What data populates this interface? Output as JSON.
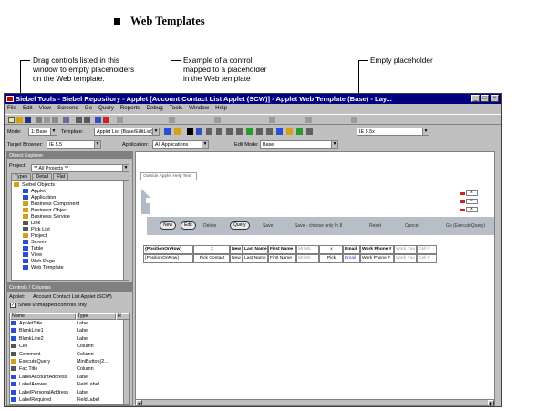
{
  "doc": {
    "heading": "Web Templates",
    "callouts": [
      "Drag controls listed in this\nwindow to empty placeholders\non the Web template.",
      "Example of a control\nmapped to a placeholder\nin the Web template",
      "Empty placeholder"
    ]
  },
  "window": {
    "title": "Siebel Tools - Siebel Repository - Applet [Account Contact List Applet (SCW)] - Applet Web Template (Base) - Lay...",
    "controls": [
      "_",
      "□",
      "×"
    ],
    "menu": [
      "File",
      "Edit",
      "View",
      "Screens",
      "Go",
      "Query",
      "Reports",
      "Debug",
      "Tools",
      "Window",
      "Help"
    ]
  },
  "toolbar2": {
    "mode_label": "Mode:",
    "mode_value": "1: Base",
    "template_label": "Template:",
    "template_value": "Applet List (Base/EditList)",
    "edit_combo": "IE 5.5x"
  },
  "toolbar3": {
    "browser_label": "Target Browser:",
    "browser_value": "IE 5.5",
    "application_label": "Application:",
    "application_value": "All Applications",
    "editmode_label": "Edit Mode:",
    "editmode_value": "Base"
  },
  "explorer": {
    "title": "Object Explorer",
    "project_label": "Project:",
    "project_value": "** All Projects **",
    "tabs": [
      "Types",
      "Detail",
      "Flat"
    ],
    "items": [
      {
        "label": "Siebel Objects",
        "color": "#d4a017"
      },
      {
        "label": "Applet",
        "color": "#2a4fd0"
      },
      {
        "label": "Application",
        "color": "#2a4fd0"
      },
      {
        "label": "Business Component",
        "color": "#d4a017"
      },
      {
        "label": "Business Object",
        "color": "#d4a017"
      },
      {
        "label": "Business Service",
        "color": "#d4a017"
      },
      {
        "label": "Link",
        "color": "#555555"
      },
      {
        "label": "Pick List",
        "color": "#555555"
      },
      {
        "label": "Project",
        "color": "#d4a017"
      },
      {
        "label": "Screen",
        "color": "#2a4fd0"
      },
      {
        "label": "Table",
        "color": "#2a4fd0"
      },
      {
        "label": "View",
        "color": "#2a4fd0"
      },
      {
        "label": "Web Page",
        "color": "#2a4fd0"
      },
      {
        "label": "Web Template",
        "color": "#2a4fd0"
      }
    ]
  },
  "controls_pane": {
    "title": "Controls / Columns",
    "applet_label": "Applet:",
    "applet_value": "Account Contact List Applet (SCW)",
    "checkbox_label": "Show unmapped controls only",
    "headers": [
      "Name",
      "Type",
      "H"
    ],
    "rows": [
      {
        "name": "AppletTitle",
        "type": "Label",
        "color": "#2a4fd0"
      },
      {
        "name": "BlankLine1",
        "type": "Label",
        "color": "#2a4fd0"
      },
      {
        "name": "BlankLine2",
        "type": "Label",
        "color": "#2a4fd0"
      },
      {
        "name": "Cell",
        "type": "Column",
        "color": "#555555"
      },
      {
        "name": "Comment",
        "type": "Column",
        "color": "#555555"
      },
      {
        "name": "ExecuteQuery",
        "type": "MiniButton(2...",
        "color": "#d4a017"
      },
      {
        "name": "Fax Title",
        "type": "Column",
        "color": "#555555"
      },
      {
        "name": "LabelAccountAddress",
        "type": "Label",
        "color": "#2a4fd0"
      },
      {
        "name": "LabelAnswer",
        "type": "FieldLabel",
        "color": "#2a4fd0"
      },
      {
        "name": "LabelPersonalAddress",
        "type": "Label",
        "color": "#2a4fd0"
      },
      {
        "name": "LabelRequired",
        "type": "FieldLabel",
        "color": "#2a4fd0"
      }
    ]
  },
  "template": {
    "outside_label": "Outside Applet Help Text",
    "buttons": [
      {
        "label": "New",
        "pill": true
      },
      {
        "label": "Edit",
        "pill": true
      },
      {
        "label": "Delete",
        "pill": false
      },
      {
        "label": "Query",
        "pill": true
      },
      {
        "label": "Save",
        "pill": false
      },
      {
        "label": "Save - choose only In 8",
        "pill": false
      },
      {
        "label": "Reset",
        "pill": false
      },
      {
        "label": "Cancel",
        "pill": false
      },
      {
        "label": "Go (ExecuteQuery)",
        "pill": false
      }
    ],
    "header_row": [
      "{PositionOnRow}",
      "x",
      "New",
      "Last Name",
      "First Name",
      "Mr/Ms",
      "x",
      "Email",
      "Work Phone #",
      "Work Fax #",
      "Cell #"
    ],
    "data_row": [
      "{PositionOnRow}",
      "Pick Contact",
      "New",
      "Last Name",
      "First Name",
      "Mr/Ms",
      "Pick",
      "Email",
      "Work Phone #",
      "Work Fax #",
      "Cell #"
    ],
    "placeholders": [
      "x",
      "x",
      "x"
    ]
  }
}
